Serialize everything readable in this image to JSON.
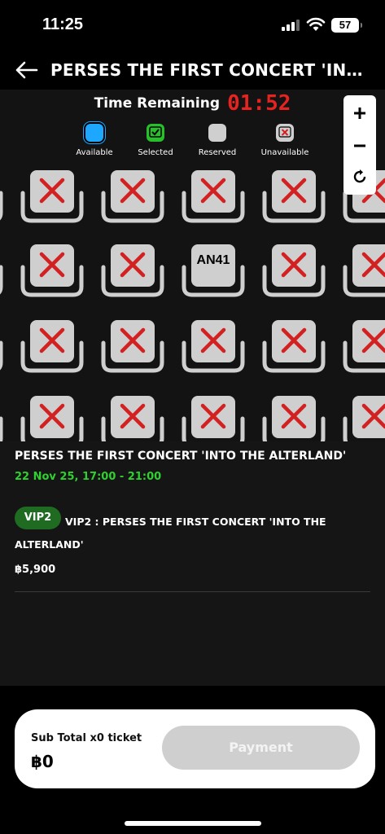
{
  "status_bar": {
    "time": "11:25",
    "battery": "57"
  },
  "header": {
    "title": "PERSES THE FIRST CONCERT 'INTO THE ALTERLAND'"
  },
  "timer": {
    "label": "Time Remaining",
    "value": "01:52",
    "color": "#e52321"
  },
  "legend": {
    "items": [
      {
        "label": "Available",
        "color": "#1ea7ff"
      },
      {
        "label": "Selected",
        "color": "#27c02b"
      },
      {
        "label": "Reserved",
        "color": "#cfcfcf"
      },
      {
        "label": "Unavailable",
        "color": "#cfcfcf"
      }
    ]
  },
  "zoom_controls": {
    "zoom_in_icon": "plus-icon",
    "zoom_out_icon": "minus-icon",
    "reset_icon": "refresh-icon"
  },
  "seat_map": {
    "rows": [
      [
        "unavailable",
        "unavailable",
        "unavailable",
        "unavailable",
        "unavailable"
      ],
      [
        "unavailable",
        "unavailable",
        "reserved",
        "unavailable",
        "unavailable"
      ],
      [
        "unavailable",
        "unavailable",
        "unavailable",
        "unavailable",
        "unavailable"
      ],
      [
        "unavailable",
        "unavailable",
        "unavailable",
        "unavailable",
        "unavailable"
      ]
    ],
    "reserved_seat_label": "AN41"
  },
  "event": {
    "title": "PERSES THE FIRST CONCERT 'INTO THE ALTERLAND'",
    "datetime": "22 Nov 25, 17:00 - 21:00",
    "zone_badge": "VIP2",
    "zone_description": "VIP2 : PERSES THE FIRST CONCERT 'INTO THE ALTERLAND'",
    "price": "฿5,900"
  },
  "checkout": {
    "subtotal_label": "Sub Total x0 ticket",
    "subtotal_value": "฿0",
    "payment_label": "Payment"
  }
}
